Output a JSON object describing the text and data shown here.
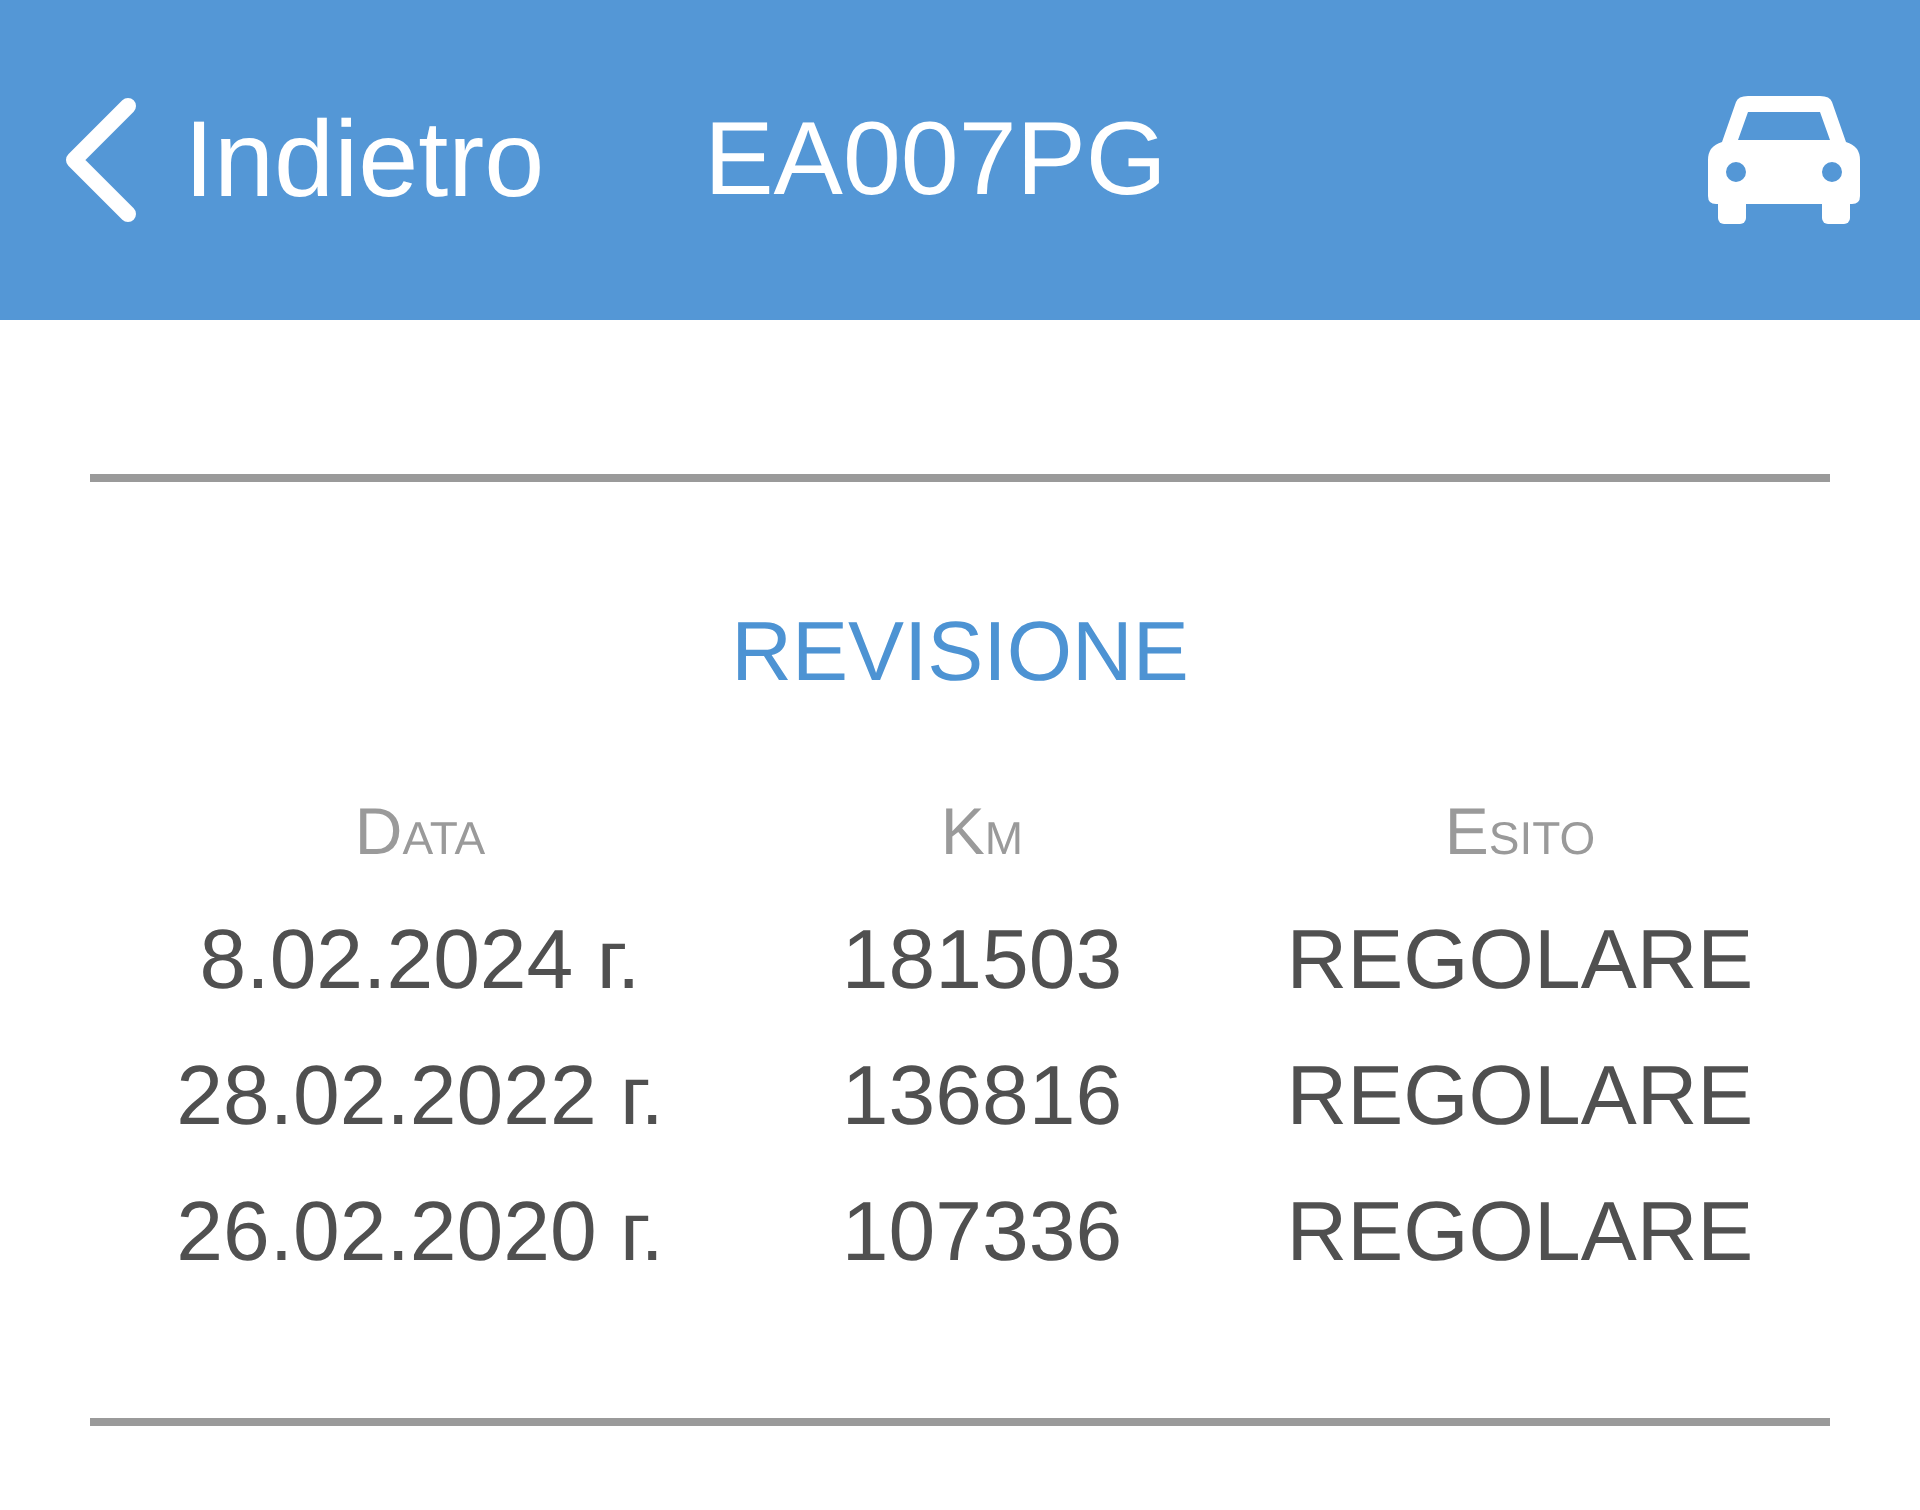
{
  "header": {
    "back_label": "Indietro",
    "title": "EA007PG"
  },
  "section": {
    "title": "REVISIONE",
    "columns": [
      "Data",
      "Km",
      "Esito"
    ],
    "rows": [
      {
        "date": "8.02.2024 г.",
        "km": "181503",
        "result": "REGOLARE"
      },
      {
        "date": "28.02.2022 г.",
        "km": "136816",
        "result": "REGOLARE"
      },
      {
        "date": "26.02.2020 г.",
        "km": "107336",
        "result": "REGOLARE"
      }
    ]
  }
}
